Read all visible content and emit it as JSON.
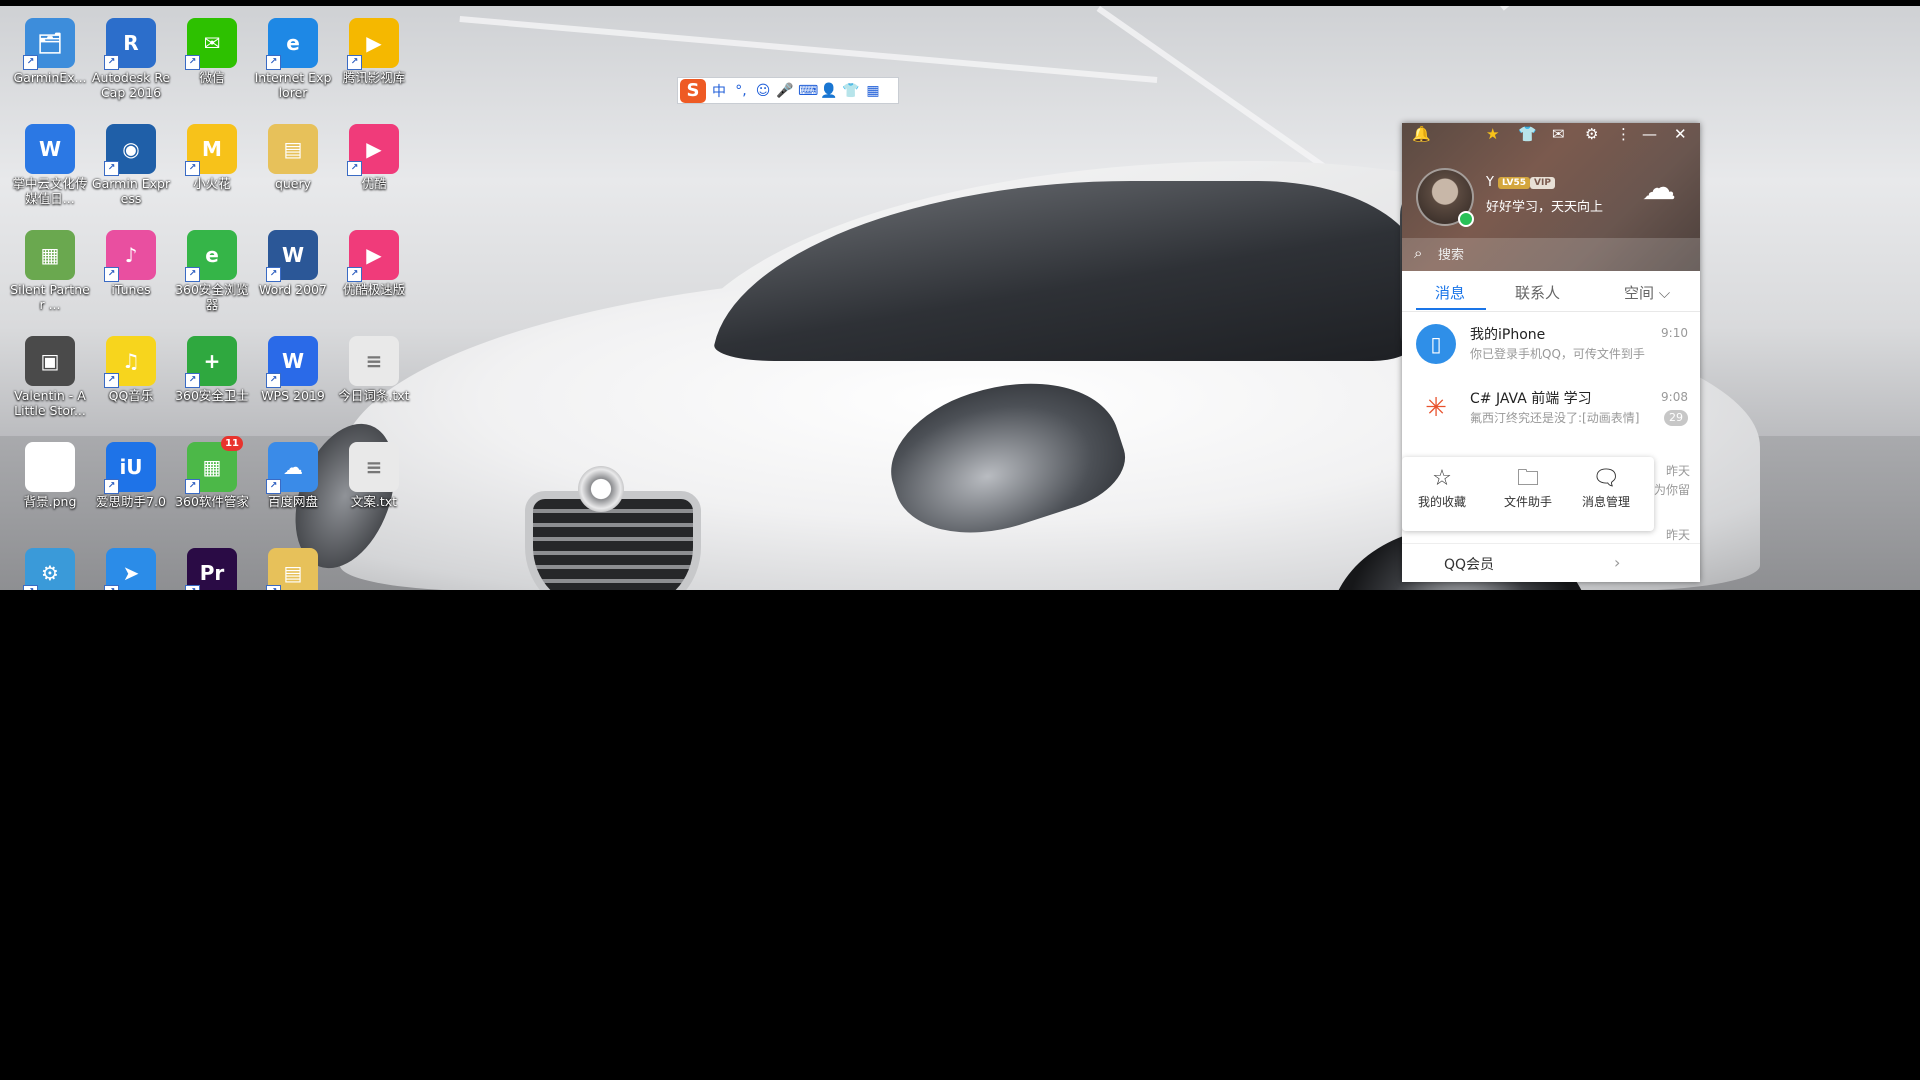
{
  "desktop": {
    "icons": [
      {
        "label": "GarminEx...",
        "icon": "garmin-express-folder-icon",
        "color": "#3d8ddb"
      },
      {
        "label": "Autodesk ReCap 2016",
        "icon": "autodesk-recap-icon",
        "color": "#2c6ecb"
      },
      {
        "label": "微信",
        "icon": "wechat-icon",
        "color": "#2dc100"
      },
      {
        "label": "Internet Explorer",
        "icon": "internet-explorer-icon",
        "color": "#1e88e5"
      },
      {
        "label": "腾讯影视库",
        "icon": "tencent-video-folder-icon",
        "color": "#f5b800"
      },
      {
        "label": "掌中云文化传媒值日...",
        "icon": "word-document-icon",
        "color": "#2b78e4"
      },
      {
        "label": "Garmin Express",
        "icon": "garmin-express-icon",
        "color": "#1f5fa8"
      },
      {
        "label": "小火花",
        "icon": "xiaohuohua-icon",
        "color": "#f7c21a"
      },
      {
        "label": "query",
        "icon": "folder-icon",
        "color": "#e7c15a"
      },
      {
        "label": "优酷",
        "icon": "youku-icon",
        "color": "#f03b7a"
      },
      {
        "label": "Silent Partner ...",
        "icon": "image-file-icon",
        "color": "#6aa84f"
      },
      {
        "label": "iTunes",
        "icon": "itunes-icon",
        "color": "#e94fa0"
      },
      {
        "label": "360安全浏览器",
        "icon": "360-browser-icon",
        "color": "#35b548"
      },
      {
        "label": "Word 2007",
        "icon": "word-2007-icon",
        "color": "#2b5797"
      },
      {
        "label": "优酷极速版",
        "icon": "youku-lite-icon",
        "color": "#f03b7a"
      },
      {
        "label": "Valentin - A Little Stor...",
        "icon": "video-file-icon",
        "color": "#4a4a4a"
      },
      {
        "label": "QQ音乐",
        "icon": "qq-music-icon",
        "color": "#f7d51d"
      },
      {
        "label": "360安全卫士",
        "icon": "360-security-icon",
        "color": "#2fa83f"
      },
      {
        "label": "WPS 2019",
        "icon": "wps-icon",
        "color": "#2a6ae8"
      },
      {
        "label": "今日词条.txt",
        "icon": "text-file-icon",
        "color": "#e9e9e9"
      },
      {
        "label": "背景.png",
        "icon": "png-file-icon",
        "color": "#ffffff"
      },
      {
        "label": "爱思助手7.0",
        "icon": "i4-assistant-icon",
        "color": "#1e73e8"
      },
      {
        "label": "360软件管家",
        "icon": "360-software-manager-icon",
        "color": "#4cb848"
      },
      {
        "label": "百度网盘",
        "icon": "baidu-netdisk-icon",
        "color": "#3a8be8"
      },
      {
        "label": "文案.txt",
        "icon": "text-file-icon",
        "color": "#e9e9e9"
      },
      {
        "label": "",
        "icon": "settings-app-icon",
        "color": "#3a9ad9"
      },
      {
        "label": "",
        "icon": "feishu-icon",
        "color": "#2b8ce8"
      },
      {
        "label": "",
        "icon": "premiere-pro-icon",
        "color": "#2a0b45"
      },
      {
        "label": "",
        "icon": "folder-icon",
        "color": "#e7c15a"
      }
    ],
    "badge_360": "11"
  },
  "ime": {
    "logo": "S",
    "items": [
      "中",
      "°,",
      "☺",
      "🎤",
      "⌨",
      "👤",
      "👕",
      "▦"
    ]
  },
  "qq": {
    "nickname": "Y",
    "vip1": "LV55",
    "vip2": "VIP",
    "signature": "好好学习，天天向上",
    "search_placeholder": "搜索",
    "tabs": {
      "messages": "消息",
      "contacts": "联系人",
      "space": "空间 ⌵"
    },
    "messages": [
      {
        "title": "我的iPhone",
        "subtitle": "你已登录手机QQ，可传文件到手",
        "time": "9:10",
        "icon": "iphone-icon"
      },
      {
        "title": "C# JAVA 前端 学习",
        "subtitle": "氟西汀终究还是没了:[动画表情]",
        "time": "9:08",
        "count": "29",
        "icon": "group-avatar-icon"
      }
    ],
    "side_times": [
      "昨天",
      "昨天"
    ],
    "side_snippet": "为你留",
    "popup": [
      {
        "label": "我的收藏",
        "icon": "favorites-icon"
      },
      {
        "label": "文件助手",
        "icon": "file-assistant-icon"
      },
      {
        "label": "消息管理",
        "icon": "message-manager-icon"
      }
    ],
    "vip_bar": "QQ会员",
    "top_icons": [
      "bell-icon",
      "star-icon",
      "skin-icon",
      "mail-icon",
      "app-manager-icon",
      "more-icon",
      "minimize-icon",
      "close-icon"
    ]
  }
}
